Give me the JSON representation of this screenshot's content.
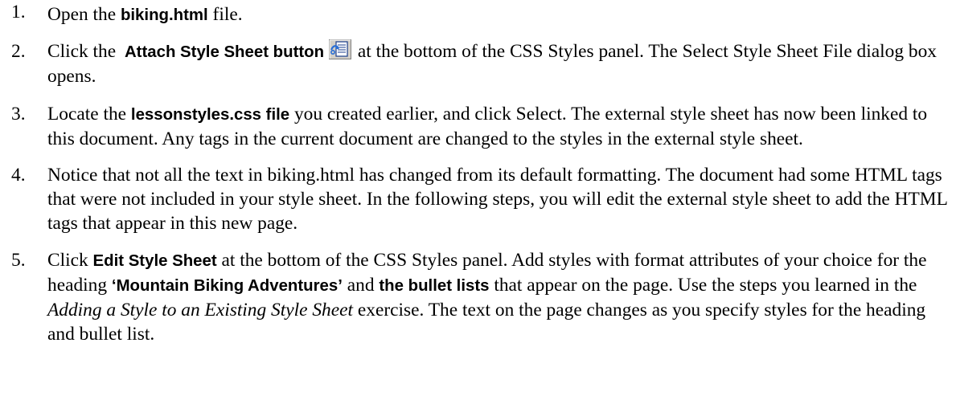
{
  "steps": [
    {
      "num": "1.",
      "parts": [
        "Open the ",
        "biking.html",
        " file."
      ]
    },
    {
      "num": "2.",
      "parts": [
        "Click the ",
        "Attach Style Sheet button",
        " at the bottom of the CSS Styles panel. The Select Style Sheet File dialog box opens."
      ],
      "icon": "attach-style-sheet-icon"
    },
    {
      "num": "3.",
      "parts": [
        "Locate the ",
        "lessonstyles.css file",
        " you created earlier, and click Select. The external style sheet has now been linked to this document. Any tags in the current document are changed to the styles in the external style sheet."
      ]
    },
    {
      "num": "4.",
      "parts": [
        "Notice that not all the text in biking.html has changed from its default formatting. The document had some HTML tags that were not included in your style sheet. In the following steps, you will edit the external style sheet to add the HTML tags that appear in this new page."
      ]
    },
    {
      "num": "5.",
      "parts": [
        "Click ",
        "Edit Style Sheet",
        " at the bottom of the CSS Styles panel. Add styles with format attributes of your choice for the heading ",
        "‘Mountain Biking Adventures’",
        " and ",
        "the bullet lists",
        " that appear on the page. Use the steps you learned in the ",
        "Adding a Style to an Existing Style Sheet",
        " exercise. The text on the page changes as you specify styles for the heading and bullet list."
      ]
    }
  ]
}
